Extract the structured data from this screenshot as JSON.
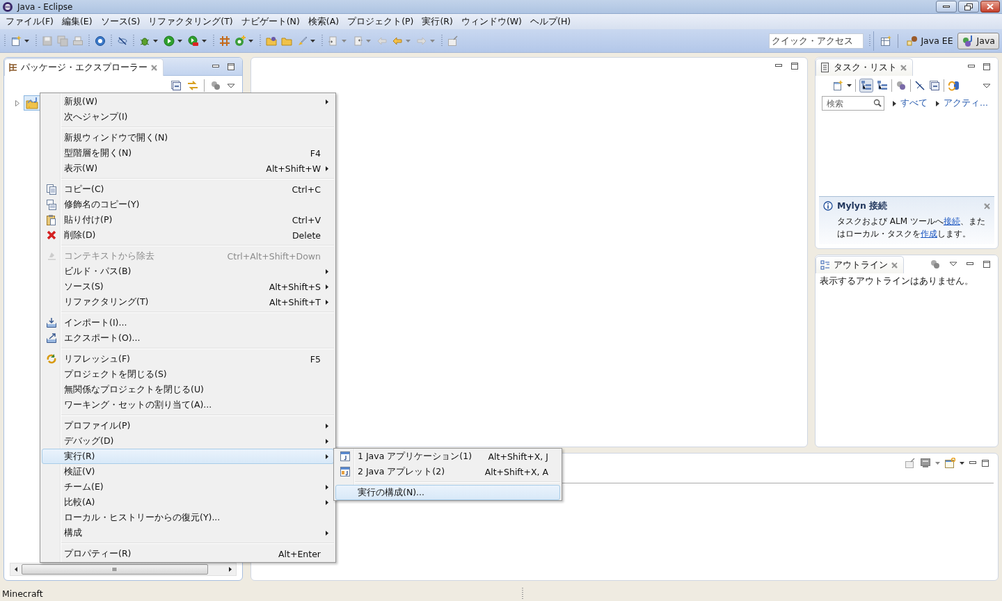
{
  "window": {
    "title": "Java - Eclipse"
  },
  "menu_bar": [
    "ファイル(F)",
    "編集(E)",
    "ソース(S)",
    "リファクタリング(T)",
    "ナビゲート(N)",
    "検索(A)",
    "プロジェクト(P)",
    "実行(R)",
    "ウィンドウ(W)",
    "ヘルプ(H)"
  ],
  "quick_access": {
    "placeholder": "クイック・アクセス"
  },
  "perspectives": [
    {
      "label": "Java EE",
      "selected": false
    },
    {
      "label": "Java",
      "selected": true
    }
  ],
  "package_explorer": {
    "title": "パッケージ・エクスプローラー",
    "tree": [
      {
        "expanded": false,
        "selected": true
      }
    ]
  },
  "task_list": {
    "title": "タスク・リスト",
    "search": {
      "placeholder": "検索"
    },
    "filters": [
      "すべて",
      "アクティ..."
    ]
  },
  "mylyn": {
    "title": "Mylyn 接続",
    "message": [
      {
        "text": "タスクおよび ALM ツールへ",
        "kind": "text"
      },
      {
        "text": "接続",
        "kind": "link"
      },
      {
        "text": "、または",
        "kind": "text"
      },
      {
        "text": "ローカル・タスクを",
        "kind": "text"
      },
      {
        "text": "作成",
        "kind": "link"
      },
      {
        "text": "します。",
        "kind": "text"
      }
    ]
  },
  "outline": {
    "title": "アウトライン",
    "message": "表示するアウトラインはありません。"
  },
  "context_menu": {
    "groups": [
      {
        "items": [
          {
            "label": "新規(W)",
            "submenu": true,
            "disabled": false,
            "selected": false
          },
          {
            "label": "次へジャンプ(I)",
            "submenu": false,
            "disabled": false,
            "selected": false
          }
        ]
      },
      {
        "items": [
          {
            "label": "新規ウィンドウで開く(N)",
            "submenu": false,
            "disabled": false,
            "selected": false
          },
          {
            "label": "型階層を開く(N)",
            "shortcut": "F4",
            "submenu": false,
            "disabled": false,
            "selected": false
          },
          {
            "label": "表示(W)",
            "shortcut": "Alt+Shift+W",
            "submenu": true,
            "disabled": false,
            "selected": false
          }
        ]
      },
      {
        "items": [
          {
            "label": "コピー(C)",
            "shortcut": "Ctrl+C",
            "submenu": false,
            "disabled": false,
            "selected": false
          },
          {
            "label": "修飾名のコピー(Y)",
            "submenu": false,
            "disabled": false,
            "selected": false
          },
          {
            "label": "貼り付け(P)",
            "shortcut": "Ctrl+V",
            "submenu": false,
            "disabled": false,
            "selected": false
          },
          {
            "label": "削除(D)",
            "shortcut": "Delete",
            "submenu": false,
            "disabled": false,
            "selected": false
          }
        ]
      },
      {
        "items": [
          {
            "label": "コンテキストから除去",
            "shortcut": "Ctrl+Alt+Shift+Down",
            "submenu": false,
            "disabled": true,
            "selected": false
          },
          {
            "label": "ビルド・パス(B)",
            "submenu": true,
            "disabled": false,
            "selected": false
          },
          {
            "label": "ソース(S)",
            "shortcut": "Alt+Shift+S",
            "submenu": true,
            "disabled": false,
            "selected": false
          },
          {
            "label": "リファクタリング(T)",
            "shortcut": "Alt+Shift+T",
            "submenu": true,
            "disabled": false,
            "selected": false
          }
        ]
      },
      {
        "items": [
          {
            "label": "インポート(I)...",
            "submenu": false,
            "disabled": false,
            "selected": false
          },
          {
            "label": "エクスポート(O)...",
            "submenu": false,
            "disabled": false,
            "selected": false
          }
        ]
      },
      {
        "items": [
          {
            "label": "リフレッシュ(F)",
            "shortcut": "F5",
            "submenu": false,
            "disabled": false,
            "selected": false
          },
          {
            "label": "プロジェクトを閉じる(S)",
            "submenu": false,
            "disabled": false,
            "selected": false
          },
          {
            "label": "無関係なプロジェクトを閉じる(U)",
            "submenu": false,
            "disabled": false,
            "selected": false
          },
          {
            "label": "ワーキング・セットの割り当て(A)...",
            "submenu": false,
            "disabled": false,
            "selected": false
          }
        ]
      },
      {
        "items": [
          {
            "label": "プロファイル(P)",
            "submenu": true,
            "disabled": false,
            "selected": false
          },
          {
            "label": "デバッグ(D)",
            "submenu": true,
            "disabled": false,
            "selected": false
          },
          {
            "label": "実行(R)",
            "submenu": true,
            "disabled": false,
            "selected": true
          },
          {
            "label": "検証(V)",
            "submenu": false,
            "disabled": false,
            "selected": false
          },
          {
            "label": "チーム(E)",
            "submenu": true,
            "disabled": false,
            "selected": false
          },
          {
            "label": "比較(A)",
            "submenu": true,
            "disabled": false,
            "selected": false
          },
          {
            "label": "ローカル・ヒストリーからの復元(Y)...",
            "submenu": false,
            "disabled": false,
            "selected": false
          },
          {
            "label": "構成",
            "submenu": true,
            "disabled": false,
            "selected": false
          }
        ]
      },
      {
        "items": [
          {
            "label": "プロパティー(R)",
            "shortcut": "Alt+Enter",
            "submenu": false,
            "disabled": false,
            "selected": false
          }
        ]
      }
    ]
  },
  "submenu": {
    "groups": [
      {
        "items": [
          {
            "label": "1 Java アプリケーション(1)",
            "shortcut": "Alt+Shift+X, J",
            "selected": false
          },
          {
            "label": "2 Java アプレット(2)",
            "shortcut": "Alt+Shift+X, A",
            "selected": false
          }
        ]
      },
      {
        "items": [
          {
            "label": "実行の構成(N)...",
            "selected": true
          }
        ]
      }
    ]
  },
  "status_bar": {
    "text": "Minecraft"
  }
}
